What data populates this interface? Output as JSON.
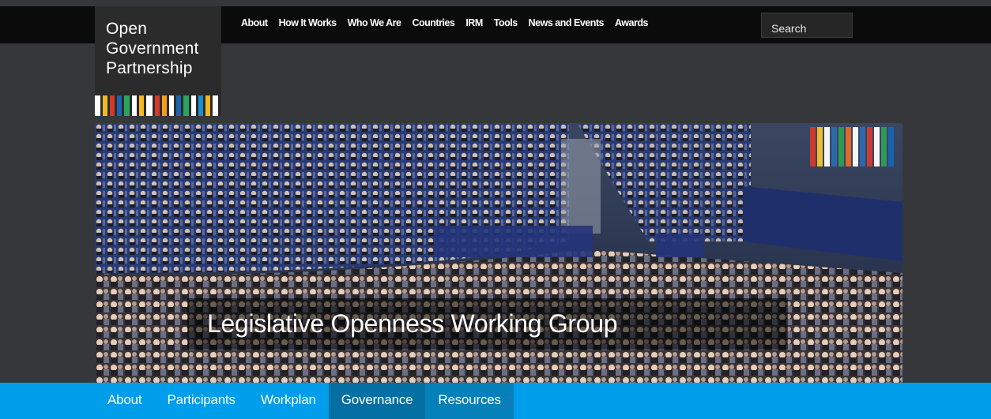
{
  "brand": {
    "logo_lines": [
      "Open",
      "Government",
      "Partnership"
    ],
    "stripe_colors": [
      "#ffffff",
      "#f0ba22",
      "#cf3a25",
      "#1c63ad",
      "#2aa55f",
      "#ffffff",
      "#f5b620",
      "#ffffff",
      "#d63a2d",
      "#f39e1d",
      "#ffffff",
      "#1c63ad",
      "#2aa55f",
      "#ffffff",
      "#1d8fcf",
      "#f5b620",
      "#ffffff"
    ]
  },
  "main_nav": {
    "items": [
      {
        "label": "About"
      },
      {
        "label": "How It Works"
      },
      {
        "label": "Who We Are"
      },
      {
        "label": "Countries"
      },
      {
        "label": "IRM"
      },
      {
        "label": "Tools"
      },
      {
        "label": "News and Events"
      },
      {
        "label": "Awards"
      }
    ],
    "search_placeholder": "Search"
  },
  "hero": {
    "title": "Legislative Openness Working Group",
    "image": "parliament-chamber-voting-photo"
  },
  "sub_nav": {
    "items": [
      {
        "label": "About",
        "state": ""
      },
      {
        "label": "Participants",
        "state": ""
      },
      {
        "label": "Workplan",
        "state": ""
      },
      {
        "label": "Governance",
        "state": "dark"
      },
      {
        "label": "Resources",
        "state": "active"
      }
    ]
  },
  "colors": {
    "top_bar": "#0b0b0b",
    "page_bg": "#36373a",
    "sub_nav_bg": "#009dea",
    "sub_nav_highlight": "#0580b9"
  }
}
